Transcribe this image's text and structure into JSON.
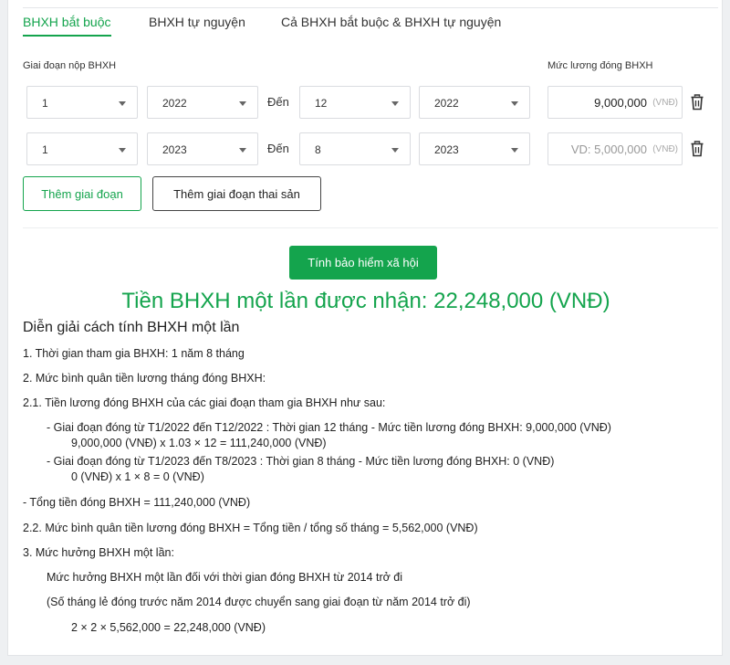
{
  "tabs": [
    {
      "label": "BHXH bắt buộc",
      "active": true
    },
    {
      "label": "BHXH tự nguyện",
      "active": false
    },
    {
      "label": "Cả BHXH bắt buộc & BHXH tự nguyện",
      "active": false
    }
  ],
  "form": {
    "period_label": "Giai đoạn nộp BHXH",
    "salary_label": "Mức lương đóng BHXH",
    "to_label": "Đến",
    "unit": "(VNĐ)",
    "rows": [
      {
        "from_month": "1",
        "from_year": "2022",
        "to_month": "12",
        "to_year": "2022",
        "salary": "9,000,000",
        "salary_placeholder": ""
      },
      {
        "from_month": "1",
        "from_year": "2023",
        "to_month": "8",
        "to_year": "2023",
        "salary": "",
        "salary_placeholder": "VD: 5,000,000"
      }
    ]
  },
  "buttons": {
    "add_period": "Thêm giai đoạn",
    "add_maternity": "Thêm giai đoạn thai sản",
    "calculate": "Tính bảo hiểm xã hội"
  },
  "result": {
    "headline": "Tiền BHXH một lần được nhận: 22,248,000 (VNĐ)"
  },
  "explanation": {
    "title": "Diễn giải cách tính BHXH một lần",
    "lines": [
      "1. Thời gian tham gia BHXH: 1 năm 8 tháng",
      "2. Mức bình quân tiền lương tháng đóng BHXH:",
      "2.1. Tiền lương đóng BHXH của các giai đoạn tham gia BHXH như sau:",
      "- Giai đoạn đóng từ T1/2022 đến T12/2022 : Thời gian 12 tháng - Mức tiền lương đóng BHXH: 9,000,000 (VNĐ)",
      "9,000,000 (VNĐ) x 1.03 × 12 = 111,240,000 (VNĐ)",
      "- Giai đoạn đóng từ T1/2023 đến T8/2023 : Thời gian 8 tháng - Mức tiền lương đóng BHXH: 0 (VNĐ)",
      "0 (VNĐ) x 1 × 8 = 0 (VNĐ)",
      "- Tổng tiền đóng BHXH = 111,240,000 (VNĐ)",
      "2.2. Mức bình quân tiền lương đóng BHXH = Tổng tiền / tổng số tháng = 5,562,000 (VNĐ)",
      "3. Mức hưởng BHXH một lần:",
      "Mức hưởng BHXH một lần đối với thời gian đóng BHXH từ 2014 trở đi",
      "(Số tháng lẻ đóng trước năm 2014 được chuyển sang giai đoạn từ năm 2014 trở đi)",
      "2 × 2 × 5,562,000 = 22,248,000 (VNĐ)"
    ]
  },
  "colors": {
    "accent": "#14a44d",
    "muted": "#999999"
  },
  "icons": {
    "dropdown": "chevron-down-icon",
    "delete": "trash-icon"
  }
}
